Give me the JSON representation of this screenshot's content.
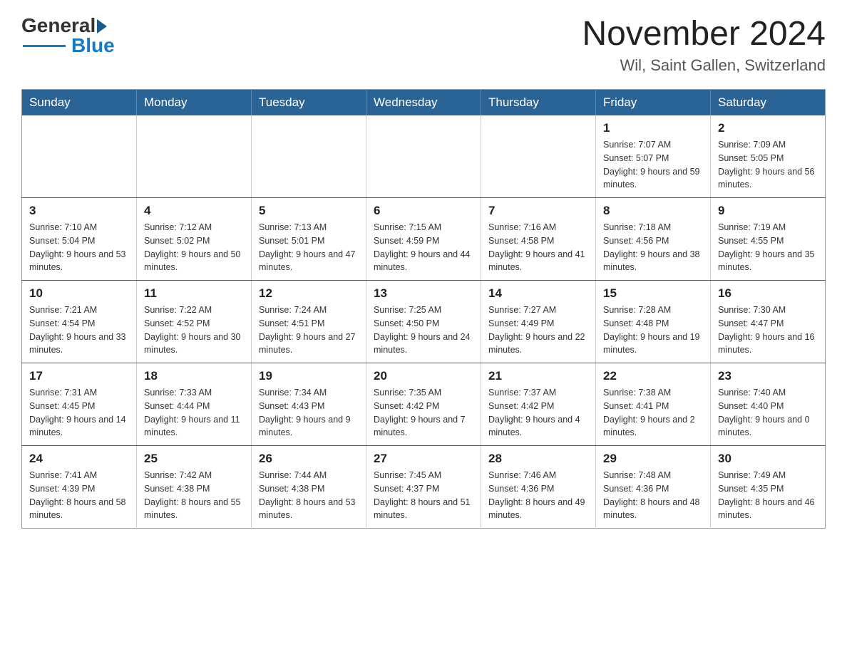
{
  "header": {
    "logo_general": "General",
    "logo_blue": "Blue",
    "month_title": "November 2024",
    "location": "Wil, Saint Gallen, Switzerland"
  },
  "weekdays": [
    "Sunday",
    "Monday",
    "Tuesday",
    "Wednesday",
    "Thursday",
    "Friday",
    "Saturday"
  ],
  "weeks": [
    {
      "days": [
        {
          "number": "",
          "info": ""
        },
        {
          "number": "",
          "info": ""
        },
        {
          "number": "",
          "info": ""
        },
        {
          "number": "",
          "info": ""
        },
        {
          "number": "",
          "info": ""
        },
        {
          "number": "1",
          "info": "Sunrise: 7:07 AM\nSunset: 5:07 PM\nDaylight: 9 hours and 59 minutes."
        },
        {
          "number": "2",
          "info": "Sunrise: 7:09 AM\nSunset: 5:05 PM\nDaylight: 9 hours and 56 minutes."
        }
      ]
    },
    {
      "days": [
        {
          "number": "3",
          "info": "Sunrise: 7:10 AM\nSunset: 5:04 PM\nDaylight: 9 hours and 53 minutes."
        },
        {
          "number": "4",
          "info": "Sunrise: 7:12 AM\nSunset: 5:02 PM\nDaylight: 9 hours and 50 minutes."
        },
        {
          "number": "5",
          "info": "Sunrise: 7:13 AM\nSunset: 5:01 PM\nDaylight: 9 hours and 47 minutes."
        },
        {
          "number": "6",
          "info": "Sunrise: 7:15 AM\nSunset: 4:59 PM\nDaylight: 9 hours and 44 minutes."
        },
        {
          "number": "7",
          "info": "Sunrise: 7:16 AM\nSunset: 4:58 PM\nDaylight: 9 hours and 41 minutes."
        },
        {
          "number": "8",
          "info": "Sunrise: 7:18 AM\nSunset: 4:56 PM\nDaylight: 9 hours and 38 minutes."
        },
        {
          "number": "9",
          "info": "Sunrise: 7:19 AM\nSunset: 4:55 PM\nDaylight: 9 hours and 35 minutes."
        }
      ]
    },
    {
      "days": [
        {
          "number": "10",
          "info": "Sunrise: 7:21 AM\nSunset: 4:54 PM\nDaylight: 9 hours and 33 minutes."
        },
        {
          "number": "11",
          "info": "Sunrise: 7:22 AM\nSunset: 4:52 PM\nDaylight: 9 hours and 30 minutes."
        },
        {
          "number": "12",
          "info": "Sunrise: 7:24 AM\nSunset: 4:51 PM\nDaylight: 9 hours and 27 minutes."
        },
        {
          "number": "13",
          "info": "Sunrise: 7:25 AM\nSunset: 4:50 PM\nDaylight: 9 hours and 24 minutes."
        },
        {
          "number": "14",
          "info": "Sunrise: 7:27 AM\nSunset: 4:49 PM\nDaylight: 9 hours and 22 minutes."
        },
        {
          "number": "15",
          "info": "Sunrise: 7:28 AM\nSunset: 4:48 PM\nDaylight: 9 hours and 19 minutes."
        },
        {
          "number": "16",
          "info": "Sunrise: 7:30 AM\nSunset: 4:47 PM\nDaylight: 9 hours and 16 minutes."
        }
      ]
    },
    {
      "days": [
        {
          "number": "17",
          "info": "Sunrise: 7:31 AM\nSunset: 4:45 PM\nDaylight: 9 hours and 14 minutes."
        },
        {
          "number": "18",
          "info": "Sunrise: 7:33 AM\nSunset: 4:44 PM\nDaylight: 9 hours and 11 minutes."
        },
        {
          "number": "19",
          "info": "Sunrise: 7:34 AM\nSunset: 4:43 PM\nDaylight: 9 hours and 9 minutes."
        },
        {
          "number": "20",
          "info": "Sunrise: 7:35 AM\nSunset: 4:42 PM\nDaylight: 9 hours and 7 minutes."
        },
        {
          "number": "21",
          "info": "Sunrise: 7:37 AM\nSunset: 4:42 PM\nDaylight: 9 hours and 4 minutes."
        },
        {
          "number": "22",
          "info": "Sunrise: 7:38 AM\nSunset: 4:41 PM\nDaylight: 9 hours and 2 minutes."
        },
        {
          "number": "23",
          "info": "Sunrise: 7:40 AM\nSunset: 4:40 PM\nDaylight: 9 hours and 0 minutes."
        }
      ]
    },
    {
      "days": [
        {
          "number": "24",
          "info": "Sunrise: 7:41 AM\nSunset: 4:39 PM\nDaylight: 8 hours and 58 minutes."
        },
        {
          "number": "25",
          "info": "Sunrise: 7:42 AM\nSunset: 4:38 PM\nDaylight: 8 hours and 55 minutes."
        },
        {
          "number": "26",
          "info": "Sunrise: 7:44 AM\nSunset: 4:38 PM\nDaylight: 8 hours and 53 minutes."
        },
        {
          "number": "27",
          "info": "Sunrise: 7:45 AM\nSunset: 4:37 PM\nDaylight: 8 hours and 51 minutes."
        },
        {
          "number": "28",
          "info": "Sunrise: 7:46 AM\nSunset: 4:36 PM\nDaylight: 8 hours and 49 minutes."
        },
        {
          "number": "29",
          "info": "Sunrise: 7:48 AM\nSunset: 4:36 PM\nDaylight: 8 hours and 48 minutes."
        },
        {
          "number": "30",
          "info": "Sunrise: 7:49 AM\nSunset: 4:35 PM\nDaylight: 8 hours and 46 minutes."
        }
      ]
    }
  ]
}
